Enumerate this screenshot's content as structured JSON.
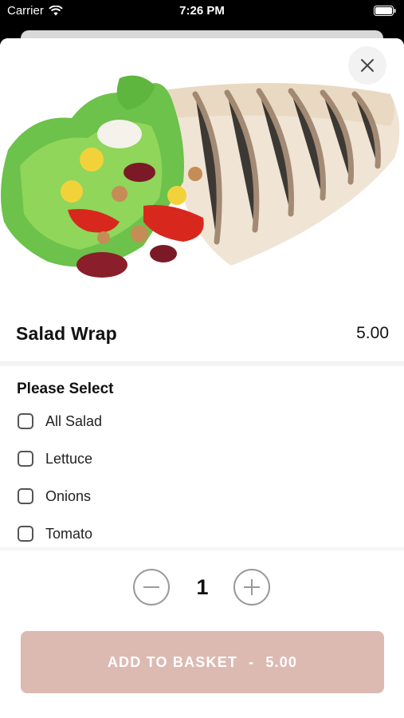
{
  "status_bar": {
    "carrier": "Carrier",
    "time": "7:26 PM"
  },
  "product": {
    "name": "Salad Wrap",
    "price": "5.00"
  },
  "options": {
    "heading": "Please Select",
    "items": [
      {
        "label": "All Salad",
        "checked": false
      },
      {
        "label": "Lettuce",
        "checked": false
      },
      {
        "label": "Onions",
        "checked": false
      },
      {
        "label": "Tomato",
        "checked": false
      }
    ]
  },
  "quantity": {
    "value": "1"
  },
  "add_button": {
    "label": "ADD TO BASKET",
    "separator": "-",
    "price": "5.00"
  },
  "colors": {
    "button_bg": "#dcbab2",
    "sheet_bg": "#ffffff"
  },
  "icons": {
    "close": "close-icon",
    "minus": "minus-icon",
    "plus": "plus-icon",
    "wifi": "wifi-icon",
    "battery": "battery-icon"
  }
}
